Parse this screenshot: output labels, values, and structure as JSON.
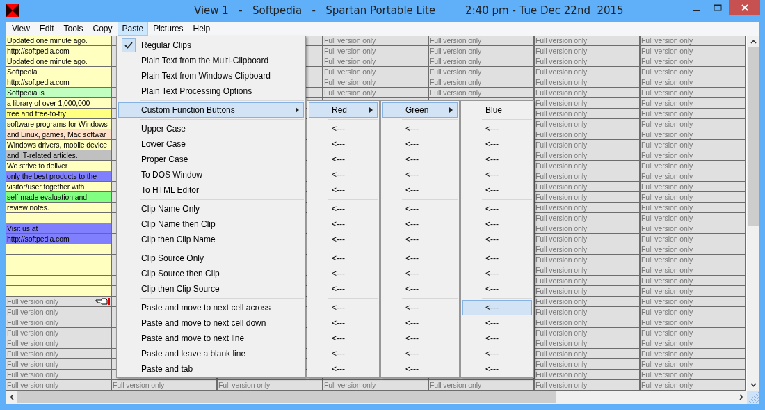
{
  "window": {
    "title": "View 1   -   Softpedia   -   Spartan Portable Lite         2:40 pm - Tue Dec 22nd  2015"
  },
  "menubar": [
    {
      "label": "View",
      "selected": false
    },
    {
      "label": "Edit",
      "selected": false
    },
    {
      "label": "Tools",
      "selected": false
    },
    {
      "label": "Copy",
      "selected": false
    },
    {
      "label": "Paste",
      "selected": true
    },
    {
      "label": "Pictures",
      "selected": false
    },
    {
      "label": "Help",
      "selected": false
    }
  ],
  "grid": {
    "rows": [
      {
        "note": {
          "text": "Updated one minute ago.",
          "color": "#ffffc0",
          "kind": "note",
          "selected": false
        },
        "cells": [
          null,
          null,
          "Full version only",
          "Full version only",
          "Full version only",
          "Full version only"
        ]
      },
      {
        "note": {
          "text": "http://softpedia.com",
          "color": "#ffffc0",
          "kind": "note",
          "selected": false
        },
        "cells": [
          null,
          null,
          "Full version only",
          "Full version only",
          "Full version only",
          "Full version only"
        ]
      },
      {
        "note": {
          "text": "Updated one minute ago.",
          "color": "#ffffc0",
          "kind": "note",
          "selected": false
        },
        "cells": [
          null,
          null,
          "Full version only",
          "Full version only",
          "Full version only",
          "Full version only"
        ]
      },
      {
        "note": {
          "text": "Softpedia",
          "color": "#ffffc0",
          "kind": "note",
          "selected": false
        },
        "cells": [
          null,
          null,
          "Full version only",
          "Full version only",
          "Full version only",
          "Full version only"
        ]
      },
      {
        "note": {
          "text": "http://softpedia.com",
          "color": "#ffffc0",
          "kind": "note",
          "selected": false
        },
        "cells": [
          null,
          null,
          "Full version only",
          "Full version only",
          "Full version only",
          "Full version only"
        ]
      },
      {
        "note": {
          "text": "Softpedia is",
          "color": "#c0ffc0",
          "kind": "note",
          "selected": false
        },
        "cells": [
          null,
          null,
          "Full version only",
          "Full version only",
          "Full version only",
          "Full version only"
        ]
      },
      {
        "note": {
          "text": "a library of over 1,000,000",
          "color": "#ffffc0",
          "kind": "note",
          "selected": false
        },
        "cells": [
          null,
          null,
          null,
          null,
          "Full version only",
          "Full version only"
        ]
      },
      {
        "note": {
          "text": "free and free-to-try",
          "color": "#ffff80",
          "kind": "note",
          "selected": false
        },
        "cells": [
          null,
          null,
          null,
          null,
          "Full version only",
          "Full version only"
        ]
      },
      {
        "note": {
          "text": "software programs for Windows",
          "color": "#ffffc0",
          "kind": "note",
          "selected": false
        },
        "cells": [
          null,
          null,
          null,
          null,
          "Full version only",
          "Full version only"
        ]
      },
      {
        "note": {
          "text": "and Linux, games, Mac softwar",
          "color": "#ffe0c8",
          "kind": "note",
          "selected": false
        },
        "cells": [
          null,
          null,
          null,
          null,
          "Full version only",
          "Full version only"
        ]
      },
      {
        "note": {
          "text": "Windows drivers, mobile device",
          "color": "#ffffc0",
          "kind": "note",
          "selected": false
        },
        "cells": [
          null,
          null,
          null,
          null,
          "Full version only",
          "Full version only"
        ]
      },
      {
        "note": {
          "text": "and IT-related articles.",
          "color": "#c0c0c0",
          "kind": "note",
          "selected": false
        },
        "cells": [
          null,
          null,
          null,
          null,
          "Full version only",
          "Full version only"
        ]
      },
      {
        "note": {
          "text": "We strive to deliver",
          "color": "#ffffc0",
          "kind": "note",
          "selected": false
        },
        "cells": [
          null,
          null,
          null,
          null,
          "Full version only",
          "Full version only"
        ]
      },
      {
        "note": {
          "text": "only the best products to the",
          "color": "#8080ff",
          "kind": "note",
          "selected": false
        },
        "cells": [
          null,
          null,
          null,
          null,
          "Full version only",
          "Full version only"
        ]
      },
      {
        "note": {
          "text": "visitor/user together with",
          "color": "#ffffc0",
          "kind": "note",
          "selected": false
        },
        "cells": [
          null,
          null,
          null,
          null,
          "Full version only",
          "Full version only"
        ]
      },
      {
        "note": {
          "text": "self-made evaluation and",
          "color": "#80ff80",
          "kind": "note",
          "selected": false
        },
        "cells": [
          null,
          null,
          null,
          null,
          "Full version only",
          "Full version only"
        ]
      },
      {
        "note": {
          "text": "review notes.",
          "color": "#ffffc0",
          "kind": "note",
          "selected": false
        },
        "cells": [
          null,
          null,
          null,
          null,
          "Full version only",
          "Full version only"
        ]
      },
      {
        "note": {
          "color": "#ffffc0",
          "kind": "note",
          "selected": false
        },
        "cells": [
          null,
          null,
          null,
          null,
          "Full version only",
          "Full version only"
        ]
      },
      {
        "note": {
          "text": "Visit us at",
          "color": "#8080ff",
          "kind": "note",
          "selected": false
        },
        "cells": [
          null,
          null,
          null,
          null,
          "Full version only",
          "Full version only"
        ]
      },
      {
        "note": {
          "text": "http://softpedia.com",
          "color": "#8080ff",
          "kind": "note",
          "selected": false
        },
        "cells": [
          null,
          null,
          null,
          null,
          "Full version only",
          "Full version only"
        ]
      },
      {
        "note": {
          "color": "#ffffc0",
          "kind": "note",
          "selected": false
        },
        "cells": [
          null,
          null,
          null,
          null,
          "Full version only",
          "Full version only"
        ]
      },
      {
        "note": {
          "color": "#ffffc0",
          "kind": "note",
          "selected": false
        },
        "cells": [
          null,
          null,
          null,
          null,
          "Full version only",
          "Full version only"
        ]
      },
      {
        "note": {
          "color": "#ffffc0",
          "kind": "note",
          "selected": false
        },
        "cells": [
          null,
          null,
          null,
          null,
          "Full version only",
          "Full version only"
        ]
      },
      {
        "note": {
          "color": "#ffffc0",
          "kind": "note",
          "selected": false
        },
        "cells": [
          null,
          null,
          null,
          null,
          "Full version only",
          "Full version only"
        ]
      },
      {
        "note": {
          "color": "#ffffc0",
          "kind": "note",
          "selected": false
        },
        "cells": [
          null,
          null,
          null,
          null,
          "Full version only",
          "Full version only"
        ]
      },
      {
        "note": {
          "text": "Full version only",
          "color": "#e0e0e0",
          "kind": "locked",
          "selected": true
        },
        "cells": [
          null,
          null,
          null,
          null,
          "Full version only",
          "Full version only"
        ]
      },
      {
        "note": {
          "text": "Full version only",
          "color": "#e0e0e0",
          "kind": "locked",
          "selected": false
        },
        "cells": [
          null,
          null,
          null,
          null,
          "Full version only",
          "Full version only"
        ]
      },
      {
        "note": {
          "text": "Full version only",
          "color": "#e0e0e0",
          "kind": "locked",
          "selected": false
        },
        "cells": [
          null,
          null,
          null,
          null,
          "Full version only",
          "Full version only"
        ]
      },
      {
        "note": {
          "text": "Full version only",
          "color": "#e0e0e0",
          "kind": "locked",
          "selected": false
        },
        "cells": [
          null,
          null,
          null,
          null,
          "Full version only",
          "Full version only"
        ]
      },
      {
        "note": {
          "text": "Full version only",
          "color": "#e0e0e0",
          "kind": "locked",
          "selected": false
        },
        "cells": [
          null,
          null,
          null,
          null,
          "Full version only",
          "Full version only"
        ]
      },
      {
        "note": {
          "text": "Full version only",
          "color": "#e0e0e0",
          "kind": "locked",
          "selected": false
        },
        "cells": [
          null,
          null,
          null,
          null,
          "Full version only",
          "Full version only"
        ]
      },
      {
        "note": {
          "text": "Full version only",
          "color": "#e0e0e0",
          "kind": "locked",
          "selected": false
        },
        "cells": [
          null,
          null,
          null,
          null,
          "Full version only",
          "Full version only"
        ]
      },
      {
        "note": {
          "text": "Full version only",
          "color": "#e0e0e0",
          "kind": "locked",
          "selected": false
        },
        "cells": [
          null,
          null,
          null,
          null,
          "Full version only",
          "Full version only"
        ]
      },
      {
        "note": {
          "text": "Full version only",
          "color": "#e0e0e0",
          "kind": "locked",
          "selected": false
        },
        "cells": [
          "Full version only",
          "Full version only",
          "Full version only",
          "Full version only",
          "Full version only",
          "Full version only"
        ]
      }
    ]
  },
  "paste_menu": {
    "items": [
      {
        "kind": "item",
        "label": "Regular Clips",
        "checked": true,
        "selected": false,
        "submenu": false
      },
      {
        "kind": "item",
        "label": "Plain Text from the Multi-Clipboard",
        "checked": false,
        "selected": false,
        "submenu": false
      },
      {
        "kind": "item",
        "label": "Plain Text from Windows Clipboard",
        "checked": false,
        "selected": false,
        "submenu": false
      },
      {
        "kind": "item",
        "label": "Plain Text Processing Options",
        "checked": false,
        "selected": false,
        "submenu": false
      },
      {
        "kind": "separator"
      },
      {
        "kind": "item",
        "label": "Custom Function Buttons",
        "checked": false,
        "selected": true,
        "submenu": true
      },
      {
        "kind": "separator"
      },
      {
        "kind": "item",
        "label": "Upper Case",
        "checked": false,
        "selected": false,
        "submenu": false
      },
      {
        "kind": "item",
        "label": "Lower Case",
        "checked": false,
        "selected": false,
        "submenu": false
      },
      {
        "kind": "item",
        "label": "Proper Case",
        "checked": false,
        "selected": false,
        "submenu": false
      },
      {
        "kind": "item",
        "label": "To DOS Window",
        "checked": false,
        "selected": false,
        "submenu": false
      },
      {
        "kind": "item",
        "label": "To HTML Editor",
        "checked": false,
        "selected": false,
        "submenu": false
      },
      {
        "kind": "separator"
      },
      {
        "kind": "item",
        "label": "Clip Name Only",
        "checked": false,
        "selected": false,
        "submenu": false
      },
      {
        "kind": "item",
        "label": "Clip Name then Clip",
        "checked": false,
        "selected": false,
        "submenu": false
      },
      {
        "kind": "item",
        "label": "Clip then Clip Name",
        "checked": false,
        "selected": false,
        "submenu": false
      },
      {
        "kind": "separator"
      },
      {
        "kind": "item",
        "label": "Clip Source Only",
        "checked": false,
        "selected": false,
        "submenu": false
      },
      {
        "kind": "item",
        "label": "Clip Source then Clip",
        "checked": false,
        "selected": false,
        "submenu": false
      },
      {
        "kind": "item",
        "label": "Clip then Clip Source",
        "checked": false,
        "selected": false,
        "submenu": false
      },
      {
        "kind": "separator"
      },
      {
        "kind": "item",
        "label": "Paste and move to next cell across",
        "checked": false,
        "selected": false,
        "submenu": false
      },
      {
        "kind": "item",
        "label": "Paste and move to next cell down",
        "checked": false,
        "selected": false,
        "submenu": false
      },
      {
        "kind": "item",
        "label": "Paste and move to next line",
        "checked": false,
        "selected": false,
        "submenu": false
      },
      {
        "kind": "item",
        "label": "Paste and leave a blank line",
        "checked": false,
        "selected": false,
        "submenu": false
      },
      {
        "kind": "item",
        "label": "Paste and tab",
        "checked": false,
        "selected": false,
        "submenu": false
      }
    ]
  },
  "submenus": [
    {
      "items": [
        {
          "kind": "item",
          "label": "Red",
          "selected": true,
          "submenu": true
        },
        {
          "kind": "separator"
        },
        {
          "kind": "item",
          "label": "<---",
          "selected": false,
          "submenu": false
        },
        {
          "kind": "item",
          "label": "<---",
          "selected": false,
          "submenu": false
        },
        {
          "kind": "item",
          "label": "<---",
          "selected": false,
          "submenu": false
        },
        {
          "kind": "item",
          "label": "<---",
          "selected": false,
          "submenu": false
        },
        {
          "kind": "item",
          "label": "<---",
          "selected": false,
          "submenu": false
        },
        {
          "kind": "separator"
        },
        {
          "kind": "item",
          "label": "<---",
          "selected": false,
          "submenu": false
        },
        {
          "kind": "item",
          "label": "<---",
          "selected": false,
          "submenu": false
        },
        {
          "kind": "item",
          "label": "<---",
          "selected": false,
          "submenu": false
        },
        {
          "kind": "separator"
        },
        {
          "kind": "item",
          "label": "<---",
          "selected": false,
          "submenu": false
        },
        {
          "kind": "item",
          "label": "<---",
          "selected": false,
          "submenu": false
        },
        {
          "kind": "item",
          "label": "<---",
          "selected": false,
          "submenu": false
        },
        {
          "kind": "separator"
        },
        {
          "kind": "item",
          "label": "<---",
          "selected": false,
          "submenu": false
        },
        {
          "kind": "item",
          "label": "<---",
          "selected": false,
          "submenu": false
        },
        {
          "kind": "item",
          "label": "<---",
          "selected": false,
          "submenu": false
        },
        {
          "kind": "item",
          "label": "<---",
          "selected": false,
          "submenu": false
        },
        {
          "kind": "item",
          "label": "<---",
          "selected": false,
          "submenu": false
        }
      ]
    },
    {
      "items": [
        {
          "kind": "item",
          "label": "Green",
          "selected": true,
          "submenu": true
        },
        {
          "kind": "separator"
        },
        {
          "kind": "item",
          "label": "<---",
          "selected": false,
          "submenu": false
        },
        {
          "kind": "item",
          "label": "<---",
          "selected": false,
          "submenu": false
        },
        {
          "kind": "item",
          "label": "<---",
          "selected": false,
          "submenu": false
        },
        {
          "kind": "item",
          "label": "<---",
          "selected": false,
          "submenu": false
        },
        {
          "kind": "item",
          "label": "<---",
          "selected": false,
          "submenu": false
        },
        {
          "kind": "separator"
        },
        {
          "kind": "item",
          "label": "<---",
          "selected": false,
          "submenu": false
        },
        {
          "kind": "item",
          "label": "<---",
          "selected": false,
          "submenu": false
        },
        {
          "kind": "item",
          "label": "<---",
          "selected": false,
          "submenu": false
        },
        {
          "kind": "separator"
        },
        {
          "kind": "item",
          "label": "<---",
          "selected": false,
          "submenu": false
        },
        {
          "kind": "item",
          "label": "<---",
          "selected": false,
          "submenu": false
        },
        {
          "kind": "item",
          "label": "<---",
          "selected": false,
          "submenu": false
        },
        {
          "kind": "separator"
        },
        {
          "kind": "item",
          "label": "<---",
          "selected": false,
          "submenu": false
        },
        {
          "kind": "item",
          "label": "<---",
          "selected": false,
          "submenu": false
        },
        {
          "kind": "item",
          "label": "<---",
          "selected": false,
          "submenu": false
        },
        {
          "kind": "item",
          "label": "<---",
          "selected": false,
          "submenu": false
        },
        {
          "kind": "item",
          "label": "<---",
          "selected": false,
          "submenu": false
        }
      ]
    },
    {
      "items": [
        {
          "kind": "item",
          "label": "Blue",
          "selected": false,
          "submenu": false
        },
        {
          "kind": "separator"
        },
        {
          "kind": "item",
          "label": "<---",
          "selected": false,
          "submenu": false
        },
        {
          "kind": "item",
          "label": "<---",
          "selected": false,
          "submenu": false
        },
        {
          "kind": "item",
          "label": "<---",
          "selected": false,
          "submenu": false
        },
        {
          "kind": "item",
          "label": "<---",
          "selected": false,
          "submenu": false
        },
        {
          "kind": "item",
          "label": "<---",
          "selected": false,
          "submenu": false
        },
        {
          "kind": "separator"
        },
        {
          "kind": "item",
          "label": "<---",
          "selected": false,
          "submenu": false
        },
        {
          "kind": "item",
          "label": "<---",
          "selected": false,
          "submenu": false
        },
        {
          "kind": "item",
          "label": "<---",
          "selected": false,
          "submenu": false
        },
        {
          "kind": "separator"
        },
        {
          "kind": "item",
          "label": "<---",
          "selected": false,
          "submenu": false
        },
        {
          "kind": "item",
          "label": "<---",
          "selected": false,
          "submenu": false
        },
        {
          "kind": "item",
          "label": "<---",
          "selected": false,
          "submenu": false
        },
        {
          "kind": "separator"
        },
        {
          "kind": "item",
          "label": "<---",
          "selected": true,
          "submenu": false
        },
        {
          "kind": "item",
          "label": "<---",
          "selected": false,
          "submenu": false
        },
        {
          "kind": "item",
          "label": "<---",
          "selected": false,
          "submenu": false
        },
        {
          "kind": "item",
          "label": "<---",
          "selected": false,
          "submenu": false
        },
        {
          "kind": "item",
          "label": "<---",
          "selected": false,
          "submenu": false
        }
      ]
    }
  ]
}
